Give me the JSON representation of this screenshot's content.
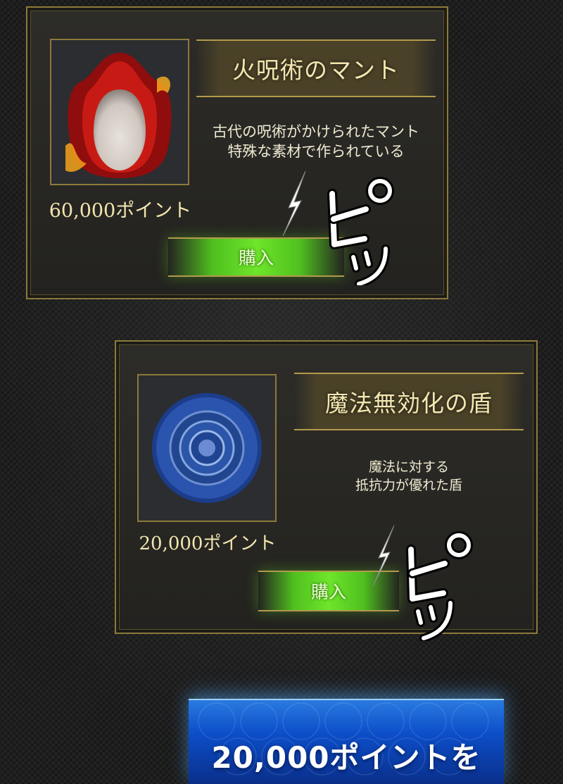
{
  "items": [
    {
      "name": "火呪術のマント",
      "description": "古代の呪術がかけられたマント\n特殊な素材で作られている",
      "price": "60,000ポイント",
      "buy_label": "購入",
      "image": "fire-cloak-icon",
      "sfx_text": "ピッ"
    },
    {
      "name": "魔法無効化の盾",
      "description": "魔法に対する\n抵抗力が優れた盾",
      "price": "20,000ポイント",
      "buy_label": "購入",
      "image": "magic-shield-icon",
      "sfx_text": "ピッ"
    }
  ],
  "banner": {
    "text": "20,000ポイントを"
  },
  "colors": {
    "gold_border": "#8c7a3c",
    "buy_green": "#6ee62a",
    "banner_blue": "#0c4ec9"
  }
}
